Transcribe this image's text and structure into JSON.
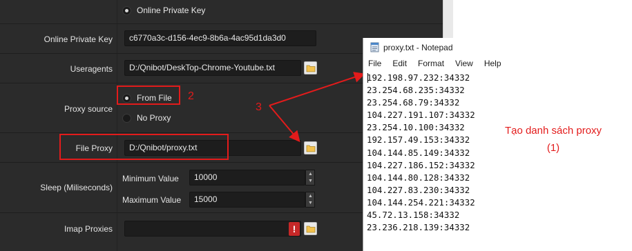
{
  "settings": {
    "online_private_key_radio_label": "Online Private Key",
    "online_private_key": {
      "label": "Online Private Key",
      "value": "c6770a3c-d156-4ec9-8b6a-4ac95d1da3d0"
    },
    "useragents": {
      "label": "Useragents",
      "value": "D:/Qnibot/DeskTop-Chrome-Youtube.txt"
    },
    "proxy_source": {
      "label": "Proxy source",
      "options": [
        "From File",
        "No Proxy"
      ],
      "selected": "From File"
    },
    "file_proxy": {
      "label": "File Proxy",
      "value": "D:/Qnibot/proxy.txt"
    },
    "sleep": {
      "label": "Sleep (Miliseconds)",
      "min_label": "Minimum Value",
      "min_value": "10000",
      "max_label": "Maximum Value",
      "max_value": "15000"
    },
    "imap_proxies": {
      "label": "Imap Proxies",
      "value": "",
      "warning": "!"
    }
  },
  "annotations": {
    "step2": "2",
    "step3": "3"
  },
  "notepad": {
    "title": "proxy.txt - Notepad",
    "menu": [
      "File",
      "Edit",
      "Format",
      "View",
      "Help"
    ],
    "lines": [
      "192.198.97.232:34332",
      "23.254.68.235:34332",
      "23.254.68.79:34332",
      "104.227.191.107:34332",
      "23.254.10.100:34332",
      "192.157.49.153:34332",
      "104.144.85.149:34332",
      "104.227.186.152:34332",
      "104.144.80.128:34332",
      "104.227.83.230:34332",
      "104.144.254.221:34332",
      "45.72.13.158:34332",
      "23.236.218.139:34332"
    ],
    "note_line1": "Tạo danh sách proxy",
    "note_line2": "(1)"
  },
  "colors": {
    "panel_bg": "#2b2b2b",
    "field_bg": "#1d1d1d",
    "annotation_red": "#e31b1b"
  }
}
